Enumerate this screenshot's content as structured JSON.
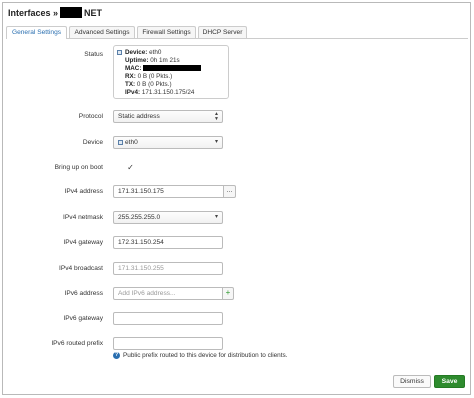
{
  "header": {
    "prefix": "Interfaces »",
    "suffix": "NET"
  },
  "tabs": [
    {
      "label": "General Settings",
      "active": true
    },
    {
      "label": "Advanced Settings",
      "active": false
    },
    {
      "label": "Firewall Settings",
      "active": false
    },
    {
      "label": "DHCP Server",
      "active": false
    }
  ],
  "status": {
    "label": "Status",
    "device_key": "Device:",
    "device_val": "eth0",
    "uptime_key": "Uptime:",
    "uptime_val": "0h 1m 21s",
    "mac_key": "MAC:",
    "rx_key": "RX:",
    "rx_val": "0 B (0 Pkts.)",
    "tx_key": "TX:",
    "tx_val": "0 B (0 Pkts.)",
    "ipv4_key": "IPv4:",
    "ipv4_val": "171.31.150.175/24"
  },
  "protocol": {
    "label": "Protocol",
    "value": "Static address"
  },
  "device": {
    "label": "Device",
    "value": "eth0"
  },
  "boot": {
    "label": "Bring up on boot",
    "checked": true,
    "mark": "✓"
  },
  "ipv4_address": {
    "label": "IPv4 address",
    "value": "171.31.150.175",
    "button": "..."
  },
  "ipv4_netmask": {
    "label": "IPv4 netmask",
    "value": "255.255.255.0"
  },
  "ipv4_gateway": {
    "label": "IPv4 gateway",
    "value": "172.31.150.254"
  },
  "ipv4_broadcast": {
    "label": "IPv4 broadcast",
    "placeholder": "171.31.150.255"
  },
  "ipv6_address": {
    "label": "IPv6 address",
    "placeholder": "Add IPv6 address...",
    "button": "+"
  },
  "ipv6_gateway": {
    "label": "IPv6 gateway",
    "value": ""
  },
  "ipv6_prefix": {
    "label": "IPv6 routed prefix",
    "value": "",
    "hint": "Public prefix routed to this device for distribution to clients.",
    "hint_icon": "?"
  },
  "footer": {
    "dismiss": "Dismiss",
    "save": "Save"
  },
  "colors": {
    "accent": "#2a6fb0",
    "save": "#2e8b2e"
  }
}
